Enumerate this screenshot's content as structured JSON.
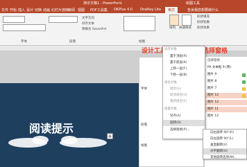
{
  "window": {
    "title": "演示文稿1 - PowerPoint",
    "right": "绘图工具"
  },
  "tabs": [
    "文件",
    "开始",
    "插入",
    "设计",
    "切换",
    "动画",
    "幻灯片放映",
    "审阅",
    "视图",
    "PDF工具集",
    "OKPlus 4.0",
    "OneKey Lite",
    "格式"
  ],
  "tell_me": "告诉我您想要做什么",
  "ribbon": {
    "arrange_btn": "排列",
    "quick_style_btn": "快速样式",
    "shape_fill": "形状填充",
    "shape_outline": "形状轮廓",
    "shape_effect": "形状效果",
    "labels": [
      "字体",
      "段落",
      "绘图"
    ],
    "text_direction": "文字方向",
    "align_text": "对齐文本",
    "convert_smartart": "转换为 SmartArt"
  },
  "heading_left": "设计工具",
  "heading_right": "选择窗格",
  "slide_text": "阅读提示",
  "plus_symbol": "+",
  "pane_labels": [
    "字体",
    "段落",
    "绘图"
  ],
  "arrange_menu": {
    "section1": "排序对象",
    "items": [
      "置于顶层(R)",
      "置于底层(K)",
      "上移一层(F)",
      "下移一层(B)"
    ],
    "section2": "组合对象",
    "group_items": [
      "组合(G)",
      "取消组合(U)",
      "重新组合(E)"
    ],
    "section3": "放置对象",
    "place_items": [
      "对齐(A)",
      "旋转(O)",
      "选择窗格(P)..."
    ]
  },
  "rotate_submenu": {
    "items": [
      "向右旋转 90°(R)",
      "向左旋转 90°(L)",
      "垂直翻转(V)",
      "水平翻转(H)",
      "其他旋转选项(M)..."
    ]
  },
  "selection_pane": {
    "title": "选择窗格",
    "items": [
      "PA 文本框 9 (简)",
      "图片 9",
      "图片 8",
      "图片 7",
      "图片 12",
      "图片 12",
      "图片 11",
      "图片 12"
    ]
  }
}
